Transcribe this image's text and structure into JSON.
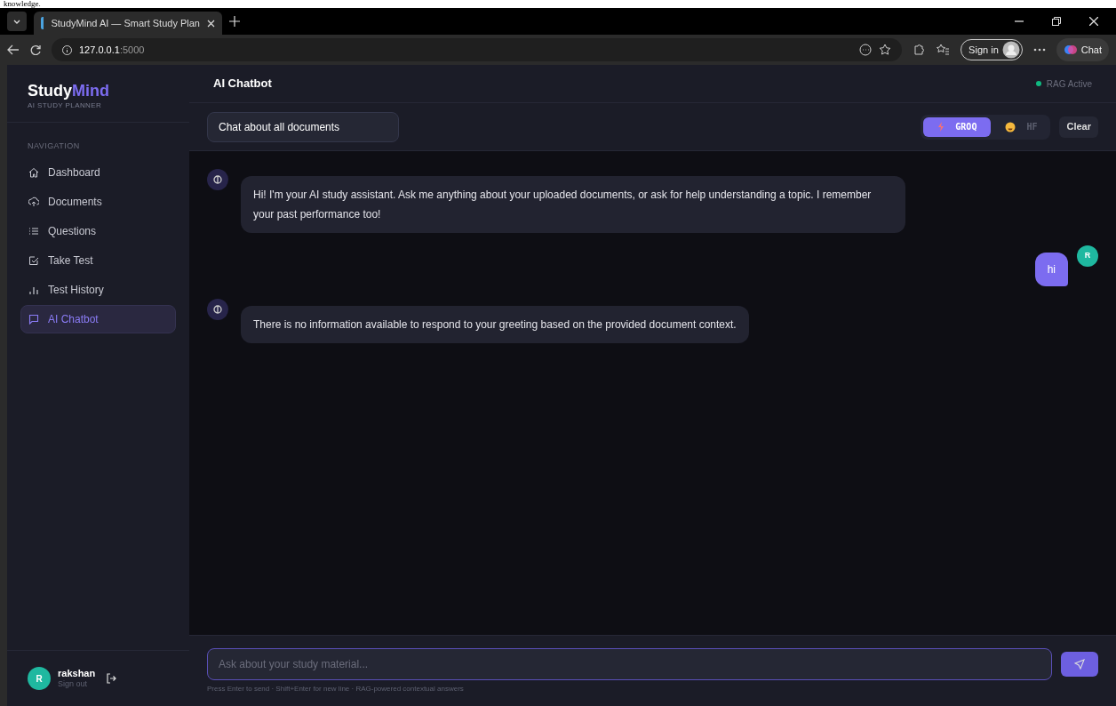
{
  "top_fragment": "knowledge.",
  "browser": {
    "tab_title": "StudyMind AI — Smart Study Plan",
    "url_host": "127.0.0.1",
    "url_port": ":5000",
    "sign_in": "Sign in",
    "chat": "Chat"
  },
  "sidebar": {
    "logo_a": "Study",
    "logo_b": "Mind",
    "subtitle": "AI STUDY PLANNER",
    "section": "NAVIGATION",
    "items": [
      {
        "label": "Dashboard",
        "selected": false
      },
      {
        "label": "Documents",
        "selected": false
      },
      {
        "label": "Questions",
        "selected": false
      },
      {
        "label": "Take Test",
        "selected": false
      },
      {
        "label": "Test History",
        "selected": false
      },
      {
        "label": "AI Chatbot",
        "selected": true
      }
    ],
    "user": {
      "initial": "R",
      "name": "rakshan",
      "sign_out": "Sign out"
    }
  },
  "header": {
    "title": "AI Chatbot",
    "status": "RAG Active"
  },
  "toolbar": {
    "scope": "Chat about all documents",
    "providers": [
      {
        "label": "GROQ",
        "selected": true
      },
      {
        "label": "HF",
        "selected": false
      }
    ],
    "clear": "Clear"
  },
  "messages": [
    {
      "kind": "assistant",
      "text": "Hi! I'm your AI study assistant. Ask me anything about your uploaded documents, or ask for help understanding a topic. I remember your past performance too!"
    },
    {
      "kind": "user",
      "text": "hi",
      "initial": "R"
    },
    {
      "kind": "assistant",
      "text": "There is no information available to respond to your greeting based on the provided document context."
    }
  ],
  "composer": {
    "placeholder": "Ask about your study material...",
    "hint": "Press Enter to send · Shift+Enter for new line · RAG-powered contextual answers"
  }
}
